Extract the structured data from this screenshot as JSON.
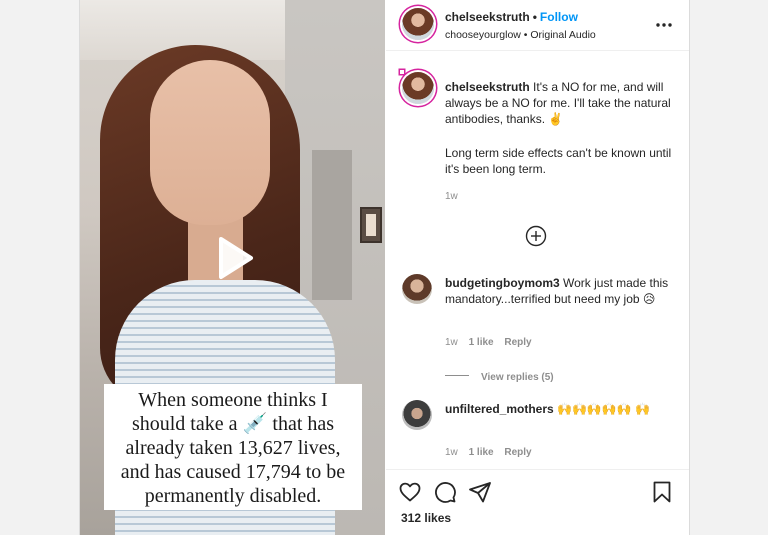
{
  "post": {
    "header": {
      "username": "chelseekstruth",
      "separator": "•",
      "follow_label": "Follow",
      "subtitle": "chooseyourglow • Original Audio",
      "more_icon": "more-horizontal-icon"
    },
    "media": {
      "play_icon": "play-icon",
      "caption_lines": [
        "When someone thinks I",
        "should take a 💉 that has",
        "already taken 13,627 lives,",
        "and has caused 17,794 to be",
        "permanently disabled."
      ]
    },
    "caption_comment": {
      "username": "chelseekstruth",
      "text1": "It's a NO for me, and will always be a NO for me. I'll take the natural antibodies, thanks. ✌️",
      "text2": "Long term side effects can't be known until it's been long term.",
      "time": "1w"
    },
    "load_more_icon": "plus-circle-icon",
    "comments": [
      {
        "username": "budgetingboymom3",
        "text": "Work just made this mandatory...terrified but need my job 😥",
        "time": "1w",
        "likes": "1 like",
        "reply_label": "Reply",
        "view_replies": "View replies (5)"
      },
      {
        "username": "unfiltered_mothers",
        "text": "🙌🙌🙌🙌🙌 🙌",
        "time": "1w",
        "likes": "1 like",
        "reply_label": "Reply"
      }
    ],
    "footer": {
      "likes": "312 likes",
      "icons": [
        "heart-icon",
        "comment-icon",
        "share-icon",
        "bookmark-icon"
      ]
    }
  }
}
